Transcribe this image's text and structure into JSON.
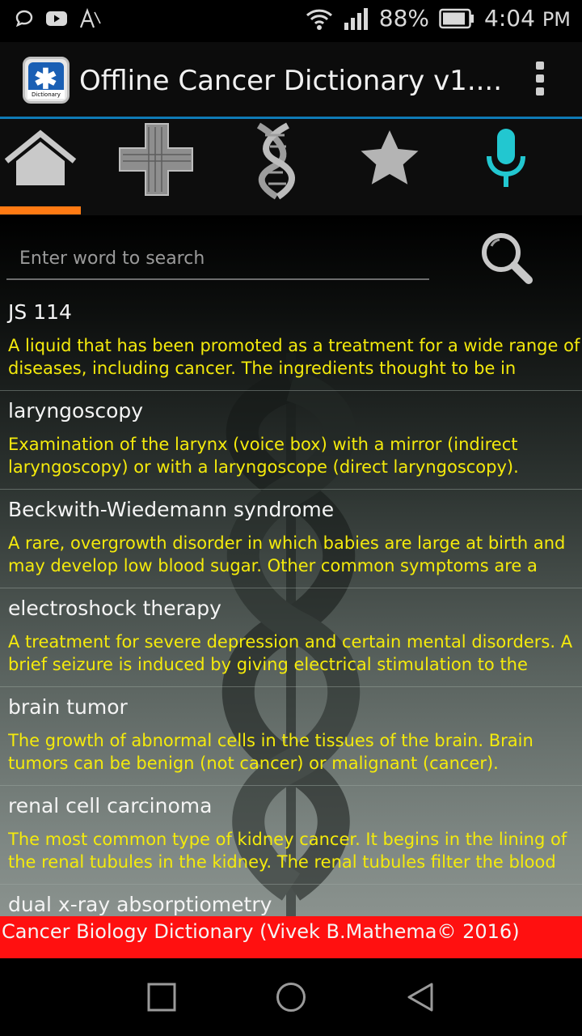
{
  "status_bar": {
    "battery": "88%",
    "time": "4:04",
    "ampm": "PM"
  },
  "app_bar": {
    "icon_caption": "Dictionary",
    "title": "Offline Cancer Dictionary  v1...."
  },
  "tabs": [
    {
      "name": "home",
      "icon": "home-icon",
      "selected": true
    },
    {
      "name": "medical-cross",
      "icon": "medical-cross-icon",
      "selected": false
    },
    {
      "name": "dna",
      "icon": "dna-icon",
      "selected": false
    },
    {
      "name": "favorites",
      "icon": "star-icon",
      "selected": false
    },
    {
      "name": "voice",
      "icon": "microphone-icon",
      "selected": false
    }
  ],
  "search": {
    "placeholder": "Enter word to search",
    "value": ""
  },
  "entries": [
    {
      "term": "JS 114",
      "definition": "A liquid that has been promoted as a treatment for a wide range of diseases, including cancer. The ingredients thought to be in"
    },
    {
      "term": "laryngoscopy",
      "definition": "Examination of the larynx (voice box) with a mirror (indirect laryngoscopy) or with a laryngoscope (direct laryngoscopy)."
    },
    {
      "term": "Beckwith-Wiedemann syndrome",
      "definition": "A rare, overgrowth disorder in which babies are large at birth and may develop low blood sugar. Other common symptoms are a"
    },
    {
      "term": "electroshock therapy",
      "definition": "A treatment for severe depression and certain mental disorders. A brief seizure is induced by giving electrical stimulation to the"
    },
    {
      "term": "brain tumor",
      "definition": "The growth of abnormal cells in the tissues of the brain. Brain tumors can be benign (not cancer) or malignant (cancer)."
    },
    {
      "term": "renal cell carcinoma",
      "definition": "The most common type of kidney cancer. It begins in the lining of the renal tubules in the kidney. The renal tubules filter the blood"
    },
    {
      "term": "dual x-ray absorptiometry",
      "definition": ""
    }
  ],
  "footer": {
    "text": "Cancer Biology Dictionary (Vivek B.Mathema© 2016)"
  },
  "colors": {
    "accent_tab_indicator": "#ff7a13",
    "tab_border": "#0f7bb6",
    "definition_text": "#f4ea0c",
    "footer_bg": "#ff1010",
    "mic_icon": "#22c7d0"
  }
}
